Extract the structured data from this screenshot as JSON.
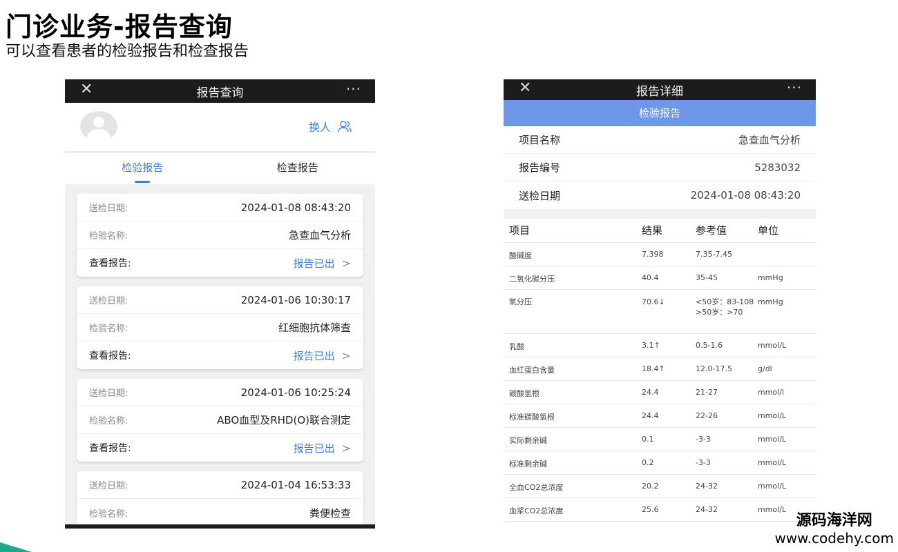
{
  "slide": {
    "title": "门诊业务-报告查询",
    "subtitle": "可以查看患者的检验报告和检查报告"
  },
  "left_phone": {
    "topbar": {
      "close": "✕",
      "title": "报告查询",
      "more": "···"
    },
    "switch_label": "换人",
    "tabs": [
      {
        "label": "检验报告",
        "active": true
      },
      {
        "label": "检查报告",
        "active": false
      }
    ],
    "cards": [
      {
        "date_label": "送检日期:",
        "date": "2024-01-08 08:43:20",
        "name_label": "检验名称:",
        "name": "急查血气分析",
        "view_label": "查看报告:",
        "status": "报告已出"
      },
      {
        "date_label": "送检日期:",
        "date": "2024-01-06 10:30:17",
        "name_label": "检验名称:",
        "name": "红细胞抗体筛查",
        "view_label": "查看报告:",
        "status": "报告已出"
      },
      {
        "date_label": "送检日期:",
        "date": "2024-01-06 10:25:24",
        "name_label": "检验名称:",
        "name": "ABO血型及RHD(O)联合测定",
        "view_label": "查看报告:",
        "status": "报告已出"
      },
      {
        "date_label": "送检日期:",
        "date": "2024-01-04 16:53:33",
        "name_label": "检验名称:",
        "name": "粪便检查"
      }
    ]
  },
  "right_phone": {
    "topbar": {
      "close": "✕",
      "title": "报告详细",
      "more": "···"
    },
    "header": "检验报告",
    "info": [
      {
        "label": "项目名称",
        "value": "急查血气分析"
      },
      {
        "label": "报告编号",
        "value": "5283032"
      },
      {
        "label": "送检日期",
        "value": "2024-01-08 08:43:20"
      }
    ],
    "table_headers": [
      "项目",
      "结果",
      "参考值",
      "单位"
    ],
    "rows": [
      {
        "item": "酸碱度",
        "result": "7.398",
        "flag": "",
        "ref": "7.35-7.45",
        "unit": ""
      },
      {
        "item": "二氧化碳分压",
        "result": "40.4",
        "flag": "",
        "ref": "35-45",
        "unit": "mmHg"
      },
      {
        "item": "氧分压",
        "result": "70.6↓",
        "flag": "low",
        "ref": "<50岁：83-108 >50岁：>70",
        "unit": "mmHg"
      },
      {
        "item": "乳酸",
        "result": "3.1↑",
        "flag": "high",
        "ref": "0.5-1.6",
        "unit": "mmol/L"
      },
      {
        "item": "血红蛋白含量",
        "result": "18.4↑",
        "flag": "high",
        "ref": "12.0-17.5",
        "unit": "g/dl"
      },
      {
        "item": "碳酸氢根",
        "result": "24.4",
        "flag": "",
        "ref": "21-27",
        "unit": "mmol/l"
      },
      {
        "item": "标准碳酸氢根",
        "result": "24.4",
        "flag": "",
        "ref": "22-26",
        "unit": "mmol/L"
      },
      {
        "item": "实际剩余碱",
        "result": "0.1",
        "flag": "",
        "ref": "-3-3",
        "unit": "mmol/L"
      },
      {
        "item": "标准剩余碱",
        "result": "0.2",
        "flag": "",
        "ref": "-3-3",
        "unit": "mmol/L"
      },
      {
        "item": "全血CO2总浓度",
        "result": "20.2",
        "flag": "",
        "ref": "24-32",
        "unit": "mmol/L"
      },
      {
        "item": "血浆CO2总浓度",
        "result": "25.6",
        "flag": "",
        "ref": "24-32",
        "unit": "mmol/L"
      }
    ]
  },
  "watermark": {
    "cn": "源码海洋网",
    "en": "www.codehy.com"
  },
  "colors": {
    "accent_blue": "#3a7de0",
    "header_blue": "#6e97e8",
    "low_green": "#2f9e3a",
    "high_red": "#e23b3b"
  }
}
